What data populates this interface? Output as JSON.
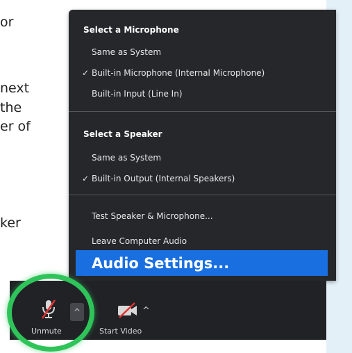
{
  "background_text": [
    "or",
    "next",
    "the",
    "er of",
    "ker"
  ],
  "menu": {
    "sections": [
      {
        "header": "Select a Microphone",
        "items": [
          {
            "label": "Same as System",
            "checked": false
          },
          {
            "label": "Built-in Microphone (Internal Microphone)",
            "checked": true
          },
          {
            "label": "Built-in Input (Line In)",
            "checked": false
          }
        ]
      },
      {
        "header": "Select a Speaker",
        "items": [
          {
            "label": "Same as System",
            "checked": false
          },
          {
            "label": "Built-in Output (Internal Speakers)",
            "checked": true
          }
        ]
      }
    ],
    "actions": [
      "Test Speaker & Microphone...",
      "Leave Computer Audio"
    ],
    "highlighted": "Audio Settings...",
    "check_glyph": "✓"
  },
  "toolbar": {
    "unmute_label": "Unmute",
    "start_video_label": "Start Video",
    "caret": "^"
  },
  "colors": {
    "menu_bg": "#26272b",
    "highlight": "#1a6fe0",
    "toolbar_bg": "#212226",
    "ring": "#2fc45a",
    "side_strip": "#e4f0f8",
    "mute_slash": "#e0322f"
  },
  "icons": {
    "microphone": "microphone-muted-icon",
    "video": "video-muted-icon"
  }
}
